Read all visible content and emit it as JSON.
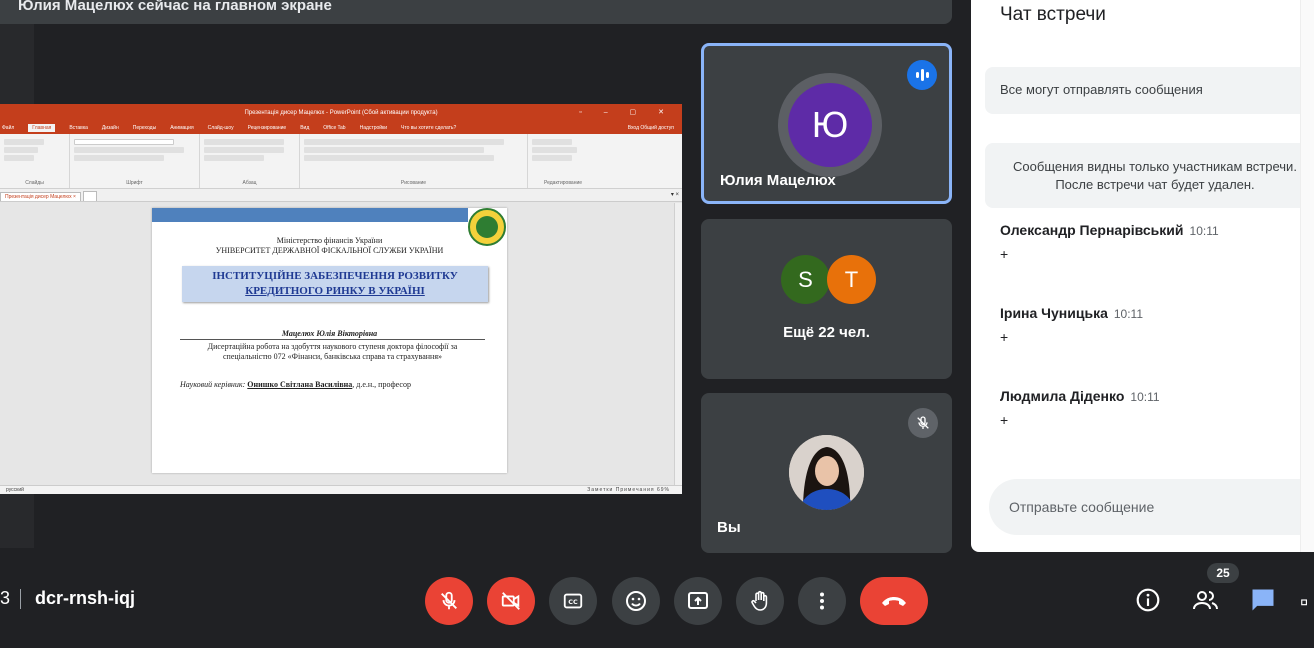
{
  "banner": {
    "text": "Юлия Мацелюх сейчас на главном экране"
  },
  "presentation": {
    "window_title": "Презентація дисер Мацелюх - PowerPoint (Сбой активации продукта)",
    "tabs": [
      "Файл",
      "Главная",
      "Вставка",
      "Дизайн",
      "Переходы",
      "Анимация",
      "Слайд-шоу",
      "Рецензирование",
      "Вид",
      "Office Tab",
      "Надстройки",
      "Что вы хотите сделать?"
    ],
    "tab_right": "Вход   Общий доступ",
    "ribbon_groups": [
      "Слайды",
      "Шрифт",
      "Абзац",
      "Рисование",
      "Редактирование"
    ],
    "doc_tab": "Презентація дисер Мацелюх",
    "slide": {
      "ministry_line1": "Міністерство фінансів України",
      "ministry_line2": "УНІВЕРСИТЕТ ДЕРЖАВНОЇ ФІСКАЛЬНОЇ СЛУЖБИ УКРАЇНИ",
      "title_line1": "ІНСТИТУЦІЙНЕ ЗАБЕЗПЕЧЕННЯ РОЗВИТКУ",
      "title_line2": "КРЕДИТНОГО РИНКУ В УКРАЇНІ",
      "author": "Мацелюх Юлія Вікторівна",
      "desc_line1": "Дисертаційна робота на здобуття наукового ступеня доктора філософії за",
      "desc_line2": "спеціальністю 072 «Фінанси, банківська справа та страхування»",
      "supervisor_label": "Науковий керівник:",
      "supervisor_name": "Онишко Світлана Василівна",
      "supervisor_rest": ", д.е.н., професор"
    },
    "status_left": "русский",
    "status_right": "Заметки   Примечания      69%"
  },
  "tiles": {
    "speaker": {
      "initial": "Ю",
      "name": "Юлия Мацелюх"
    },
    "others": {
      "a": "S",
      "b": "T",
      "label": "Ещё 22 чел."
    },
    "you": {
      "name": "Вы"
    }
  },
  "chat": {
    "title": "Чат встречи",
    "setting": "Все могут отправлять сообщения",
    "notice_line1": "Сообщения видны только участникам встречи.",
    "notice_line2": "После встречи чат будет удален.",
    "messages": [
      {
        "sender": "Олександр Пернарівський",
        "time": "10:11",
        "text": "+"
      },
      {
        "sender": "Ірина Чуницька",
        "time": "10:11",
        "text": "+"
      },
      {
        "sender": "Людмила Діденко",
        "time": "10:11",
        "text": "+"
      }
    ],
    "input_placeholder": "Отправьте сообщение"
  },
  "bottom": {
    "time_fragment": "3",
    "meeting_code": "dcr-rnsh-iqj",
    "participants_count": "25"
  },
  "colors": {
    "accent": "#8ab4f8",
    "danger": "#ea4335",
    "bg": "#202124",
    "tile": "#3c4043"
  }
}
